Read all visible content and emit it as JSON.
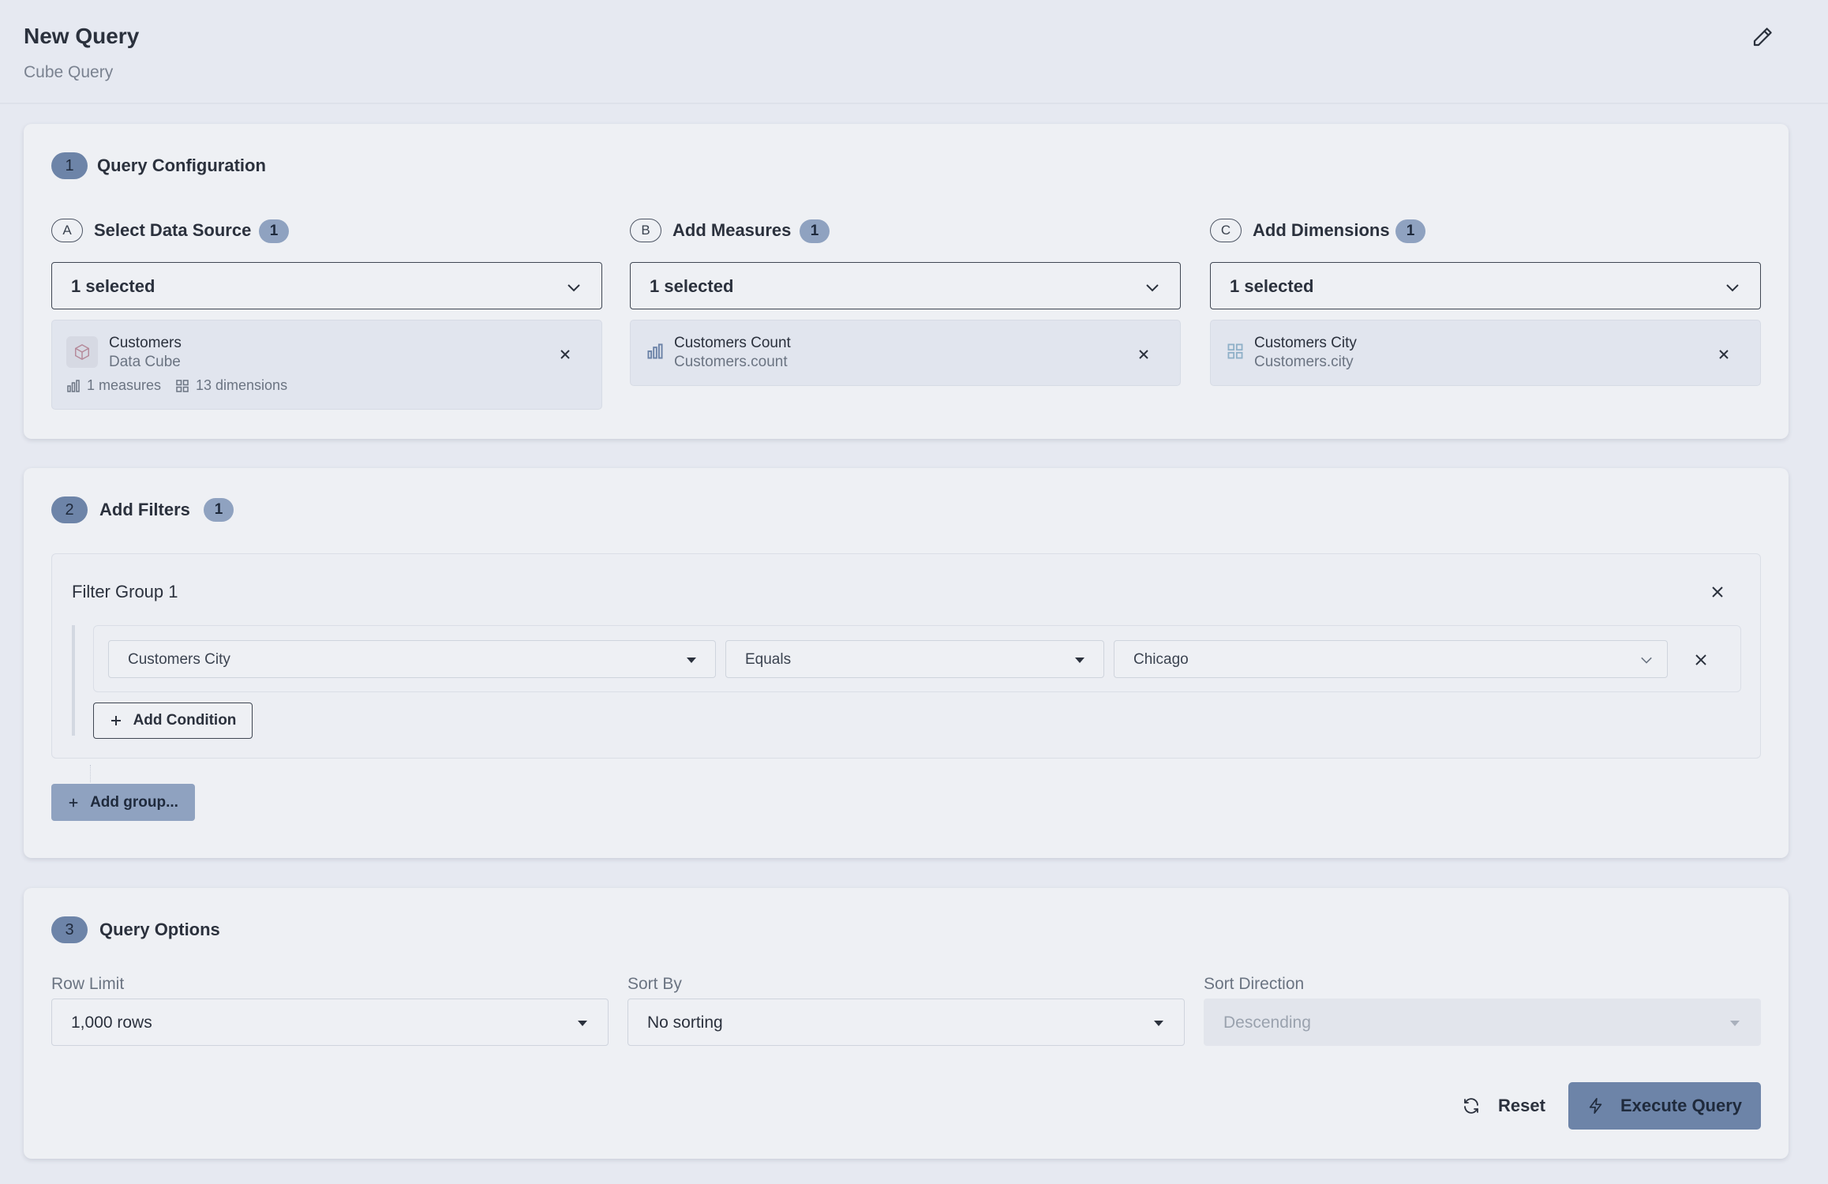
{
  "header": {
    "title": "New Query",
    "subtitle": "Cube Query"
  },
  "config": {
    "step": "1",
    "title": "Query Configuration",
    "columns": [
      {
        "letter": "A",
        "title": "Select Data Source",
        "count": "1",
        "value": "1 selected",
        "chip": {
          "name": "Customers",
          "sub": "Data Cube",
          "measures": "1 measures",
          "dimensions": "13 dimensions"
        }
      },
      {
        "letter": "B",
        "title": "Add Measures",
        "count": "1",
        "value": "1 selected",
        "chip": {
          "name": "Customers Count",
          "sub": "Customers.count"
        }
      },
      {
        "letter": "C",
        "title": "Add Dimensions",
        "count": "1",
        "value": "1 selected",
        "chip": {
          "name": "Customers City",
          "sub": "Customers.city"
        }
      }
    ]
  },
  "filters": {
    "step": "2",
    "title": "Add Filters",
    "count": "1",
    "group": {
      "title": "Filter Group 1",
      "condition": {
        "field": "Customers City",
        "operator": "Equals",
        "value": "Chicago"
      },
      "add_condition_label": "Add Condition"
    },
    "add_group_label": "Add group..."
  },
  "options": {
    "step": "3",
    "title": "Query Options",
    "row_limit": {
      "label": "Row Limit",
      "value": "1,000 rows"
    },
    "sort_by": {
      "label": "Sort By",
      "value": "No sorting"
    },
    "sort_direction": {
      "label": "Sort Direction",
      "value": "Descending"
    },
    "reset_label": "Reset",
    "execute_label": "Execute Query"
  },
  "icons": {
    "edit": "pencil-icon",
    "chevron": "chevron-down-icon",
    "close": "close-icon",
    "cube": "cube-icon",
    "bar_chart": "bar-chart-icon",
    "grid": "grid-icon",
    "plus": "plus-icon",
    "refresh": "refresh-icon",
    "bolt": "lightning-icon"
  },
  "colors": {
    "accent": "#6d84a8",
    "pill": "#8fa2c0",
    "background": "#e6e9f1",
    "card": "#eef0f4"
  }
}
